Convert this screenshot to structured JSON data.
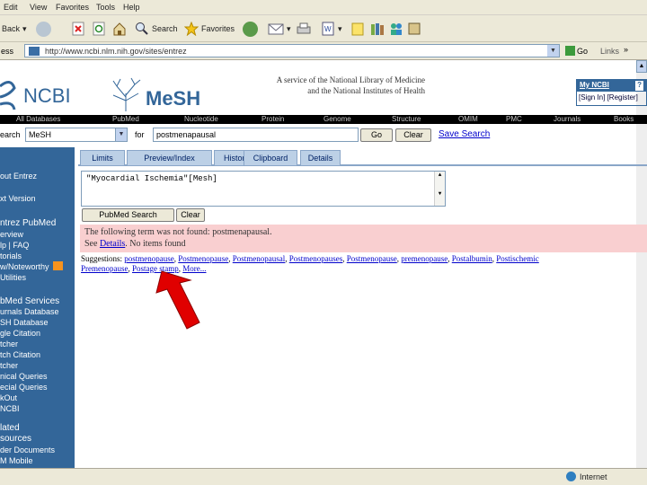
{
  "menu": [
    "Edit",
    "View",
    "Favorites",
    "Tools",
    "Help"
  ],
  "toolbar": {
    "back_label": "Back",
    "search_label": "Search",
    "favorites_label": "Favorites"
  },
  "address": {
    "label": "ess",
    "url": "http://www.ncbi.nlm.nih.gov/sites/entrez",
    "go_label": "Go",
    "links_label": "Links",
    "links_chevron": "»"
  },
  "header": {
    "ncbi_label": "NCBI",
    "mesh_label": "MeSH",
    "service_line1": "A service of the National Library of Medicine",
    "service_line2": "and the National Institutes of Health",
    "my_ncbi": "My NCBI",
    "help_q": "?",
    "sign_in": "[Sign In] [Register]"
  },
  "navstrip": [
    "All Databases",
    "PubMed",
    "Nucleotide",
    "Protein",
    "Genome",
    "Structure",
    "OMIM",
    "PMC",
    "Journals",
    "Books"
  ],
  "search": {
    "search_label": "earch",
    "db_value": "MeSH",
    "for_label": "for",
    "term_value": "postmenapausal",
    "go_button": "Go",
    "clear_button": "Clear",
    "save_search": "Save Search"
  },
  "tabs": [
    "Limits",
    "Preview/Index",
    "History",
    "Clipboard",
    "Details"
  ],
  "query": {
    "text": "\"Myocardial Ischemia\"[Mesh]",
    "pubmed_search_button": "PubMed Search",
    "clear_button": "Clear"
  },
  "error": {
    "line1": "The following term was not found: postmenapausal.",
    "see": "See",
    "details_link": "Details",
    "rest": ". No items found"
  },
  "suggestions": {
    "label": "Suggestions:",
    "items": [
      "postmenopause",
      "Postmenopause",
      "Postmenopausal",
      "Postmenopauses",
      "Postmenopause",
      "premenopause",
      "Postalbumin",
      "Postischemic",
      "Premenopause",
      "Postage stamp",
      "More..."
    ]
  },
  "sidebar": {
    "items": [
      "out Entrez",
      "xt Version",
      "ntrez PubMed",
      "erview",
      "lp | FAQ",
      "torials",
      "w/Noteworthy",
      "Utilities",
      "bMed Services",
      "urnals Database",
      "SH Database",
      "gle Citation",
      "tcher",
      "tch Citation",
      "tcher",
      "nical Queries",
      "ecial Queries",
      "kOut",
      "NCBI",
      "lated",
      "sources",
      "der Documents",
      "M Mobile"
    ]
  },
  "status": {
    "zone": "Internet"
  },
  "colors": {
    "sidebar": "#336699",
    "error_bg": "#f9cfd0",
    "link": "#0000cc",
    "arrow": "#e00000"
  }
}
